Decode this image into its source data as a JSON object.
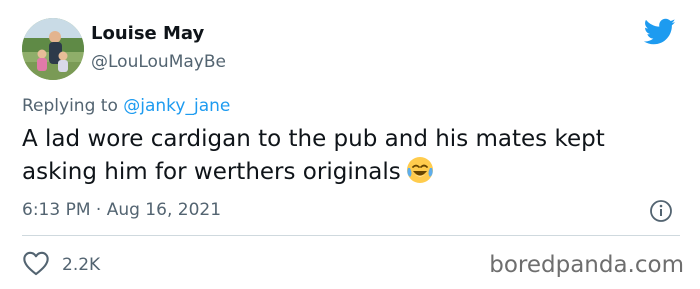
{
  "tweet": {
    "display_name": "Louise May",
    "handle": "@LouLouMayBe",
    "replying_prefix": "Replying to",
    "replying_to": "@janky_jane",
    "text": "A lad wore cardigan to the pub and his mates kept asking him for werthers originals",
    "emoji": "face-with-tears-of-joy",
    "timestamp": "6:13 PM · Aug 16, 2021",
    "likes": "2.2K"
  },
  "icons": {
    "logo": "twitter-bird-icon",
    "info": "info-icon",
    "like": "heart-icon"
  },
  "colors": {
    "twitter_blue": "#1d9bf0",
    "text": "#0f1419",
    "secondary": "#536471",
    "divider": "#cfd9de"
  },
  "watermark": "boredpanda.com"
}
